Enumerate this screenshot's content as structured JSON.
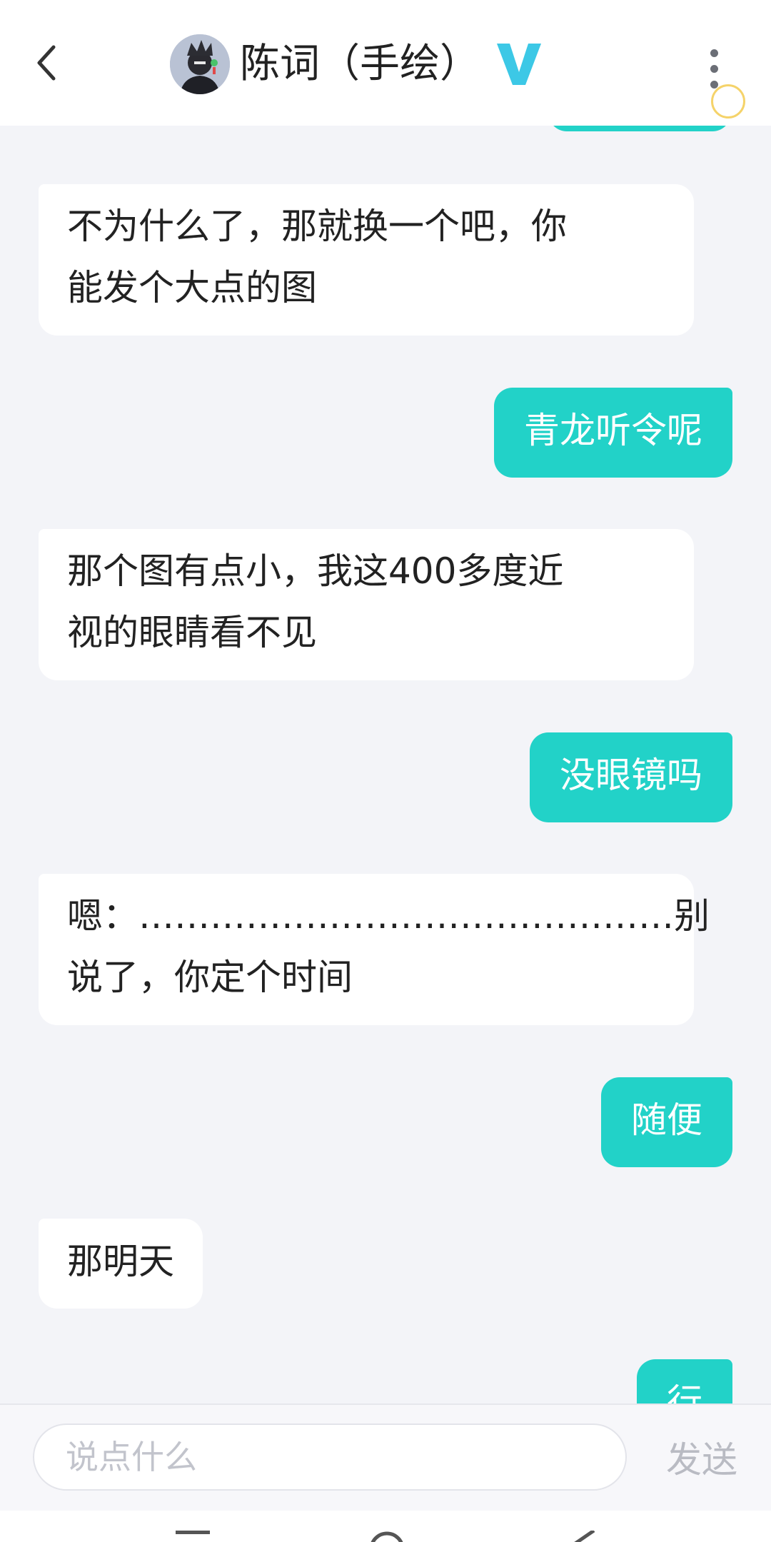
{
  "header": {
    "title": "陈词（手绘）",
    "back_icon": "chevron-left-icon",
    "badge_icon": "verified-v-icon",
    "more_icon": "more-vertical-icon"
  },
  "messages": [
    {
      "side": "out",
      "lines": [
        ""
      ]
    },
    {
      "side": "in",
      "lines": [
        "不为什么了，那就换一个吧，你",
        "能发个大点的图"
      ]
    },
    {
      "side": "out",
      "lines": [
        "青龙听令呢"
      ]
    },
    {
      "side": "in",
      "lines": [
        "那个图有点小，我这400多度近",
        "视的眼睛看不见"
      ]
    },
    {
      "side": "out",
      "lines": [
        "没眼镜吗"
      ]
    },
    {
      "side": "in",
      "lines": [
        "嗯：………………………………………别",
        "说了，你定个时间"
      ]
    },
    {
      "side": "out",
      "lines": [
        "随便"
      ]
    },
    {
      "side": "in",
      "lines": [
        "那明天"
      ]
    },
    {
      "side": "out",
      "lines": [
        "行"
      ]
    }
  ],
  "composer": {
    "placeholder": "说点什么",
    "send_label": "发送"
  },
  "navbar": {
    "items": [
      "menu-icon",
      "home-icon",
      "back-icon"
    ]
  },
  "colors": {
    "accent": "#22d2c8",
    "badge": "#3cc8e6",
    "background": "#f3f4f8"
  }
}
